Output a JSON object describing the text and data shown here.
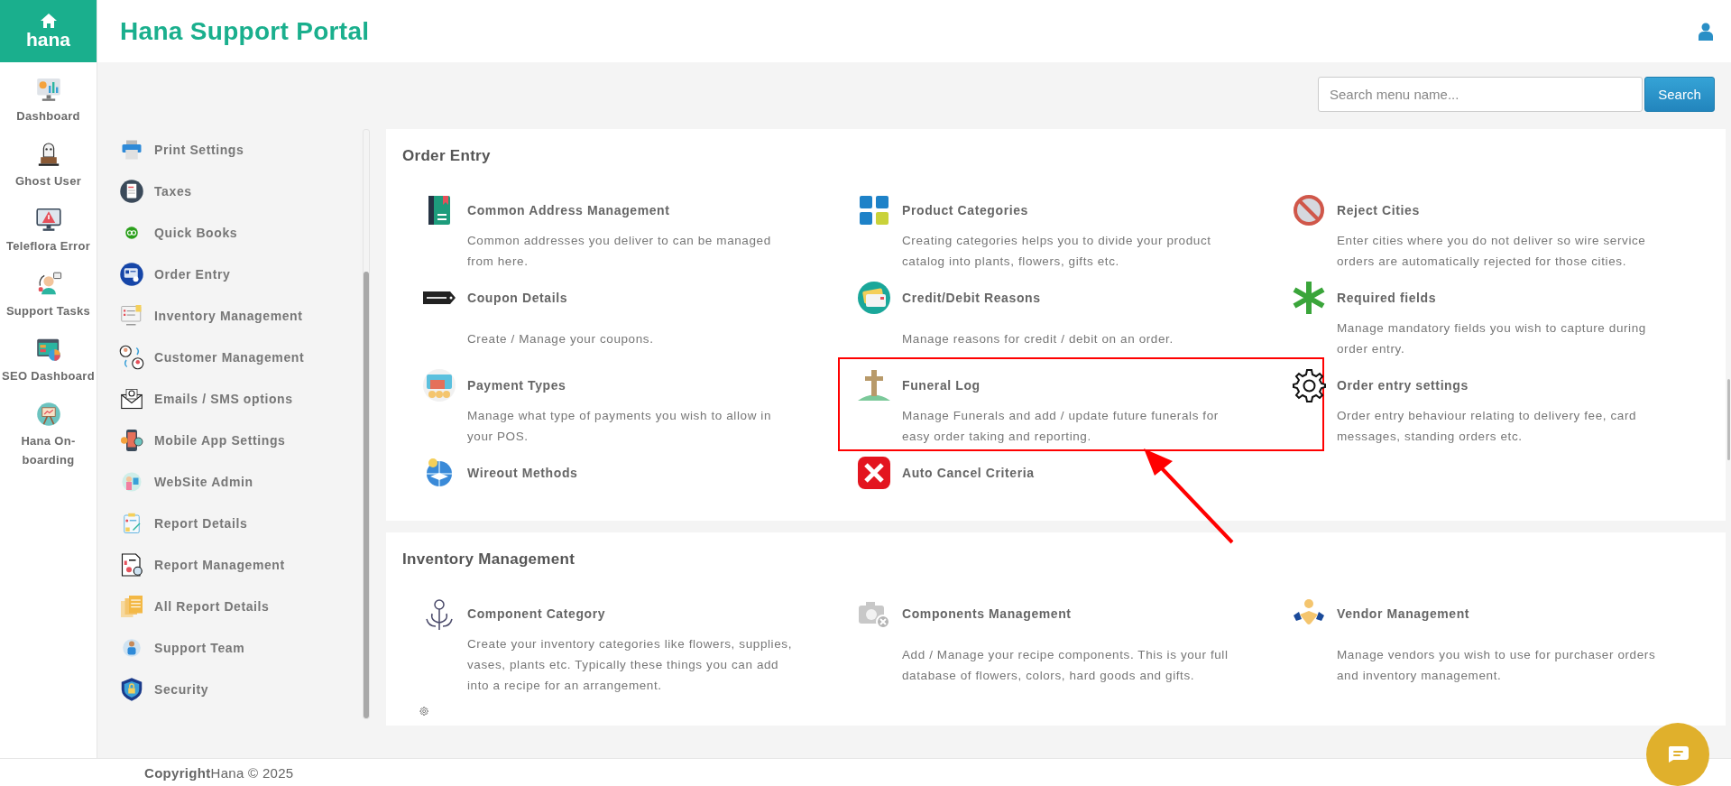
{
  "brand": {
    "name": "hana"
  },
  "header": {
    "title": "Hana Support Portal"
  },
  "rail": [
    {
      "label": "Dashboard",
      "kind": "dashboard"
    },
    {
      "label": "Ghost User",
      "kind": "ghost"
    },
    {
      "label": "Teleflora Error",
      "kind": "alert"
    },
    {
      "label": "Support Tasks",
      "kind": "support"
    },
    {
      "label": "SEO Dashboard",
      "kind": "seo"
    },
    {
      "label": "Hana On-boarding",
      "kind": "onboarding"
    }
  ],
  "search": {
    "placeholder": "Search menu name...",
    "button": "Search"
  },
  "menu": [
    {
      "label": "Print Settings",
      "kind": "print"
    },
    {
      "label": "Taxes",
      "kind": "taxes"
    },
    {
      "label": "Quick Books",
      "kind": "quickbooks"
    },
    {
      "label": "Order Entry",
      "kind": "order"
    },
    {
      "label": "Inventory Management",
      "kind": "inventory"
    },
    {
      "label": "Customer Management",
      "kind": "customers"
    },
    {
      "label": "Emails / SMS options",
      "kind": "email"
    },
    {
      "label": "Mobile App Settings",
      "kind": "mobile"
    },
    {
      "label": "WebSite Admin",
      "kind": "website"
    },
    {
      "label": "Report Details",
      "kind": "report"
    },
    {
      "label": "Report Management",
      "kind": "reportmgmt"
    },
    {
      "label": "All Report Details",
      "kind": "allreports"
    },
    {
      "label": "Support Team",
      "kind": "team"
    },
    {
      "label": "Security",
      "kind": "security"
    }
  ],
  "sections": [
    {
      "title": "Order Entry",
      "items": [
        {
          "title": "Common Address Management",
          "description": "Common addresses you deliver to can be managed from here.",
          "kind": "book",
          "highlighted": false
        },
        {
          "title": "Product Categories",
          "description": "Creating categories helps you to divide your product catalog into plants, flowers, gifts etc.",
          "kind": "grid",
          "highlighted": false
        },
        {
          "title": "Reject Cities",
          "description": "Enter cities where you do not deliver so wire service orders are automatically rejected for those cities.",
          "kind": "noentry",
          "highlighted": false
        },
        {
          "title": "Coupon Details",
          "description": "Create / Manage your coupons.",
          "kind": "tag",
          "highlighted": false
        },
        {
          "title": "Credit/Debit Reasons",
          "description": "Manage reasons for credit / debit on an order.",
          "kind": "cards",
          "highlighted": false
        },
        {
          "title": "Required fields",
          "description": "Manage mandatory fields you wish to capture during order entry.",
          "kind": "asterisk",
          "highlighted": false
        },
        {
          "title": "Payment Types",
          "description": "Manage what type of payments you wish to allow in your POS.",
          "kind": "payment",
          "highlighted": false
        },
        {
          "title": "Funeral Log",
          "description": "Manage Funerals and add / update future funerals for easy order taking and reporting.",
          "kind": "cross",
          "highlighted": true
        },
        {
          "title": "Order entry settings",
          "description": "Order entry behaviour relating to delivery fee, card messages, standing orders etc.",
          "kind": "gear",
          "highlighted": false
        },
        {
          "title": "Wireout Methods",
          "kind": "globe",
          "highlighted": false
        },
        {
          "title": "Auto Cancel Criteria",
          "kind": "xmark",
          "highlighted": false
        }
      ]
    },
    {
      "title": "Inventory Management",
      "items": [
        {
          "title": "Component Category",
          "description": "Create your inventory categories like flowers, supplies, vases, plants etc. Typically these things you can add into a recipe for an arrangement.",
          "kind": "flower",
          "highlighted": false
        },
        {
          "title": "Components Management",
          "description": "Add / Manage your recipe components. This is your full database of flowers, colors, hard goods and gifts.",
          "kind": "camera",
          "highlighted": false
        },
        {
          "title": "Vendor Management",
          "description": "Manage vendors you wish to use for purchaser orders and inventory management.",
          "kind": "handshake",
          "highlighted": false
        }
      ]
    }
  ],
  "footer": {
    "text": "**Copyright**Hana © 2025"
  }
}
